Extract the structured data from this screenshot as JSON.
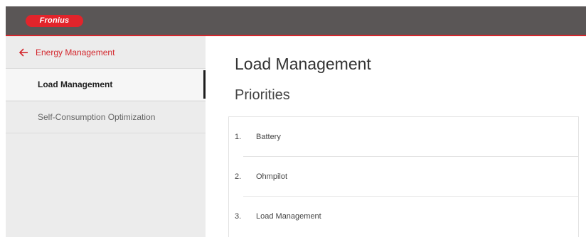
{
  "header": {
    "logo_text": "Fronius",
    "background_color": "#5a5656",
    "accent_color": "#d3262c"
  },
  "sidebar": {
    "back_icon": "arrow-left-icon",
    "back_label": "Energy Management",
    "items": [
      {
        "label": "Load Management",
        "active": true
      },
      {
        "label": "Self-Consumption Optimization",
        "active": false
      }
    ]
  },
  "main": {
    "title": "Load Management",
    "section_title": "Priorities",
    "priorities": [
      {
        "number": "1.",
        "label": "Battery"
      },
      {
        "number": "2.",
        "label": "Ohmpilot"
      },
      {
        "number": "3.",
        "label": "Load Management"
      }
    ]
  }
}
